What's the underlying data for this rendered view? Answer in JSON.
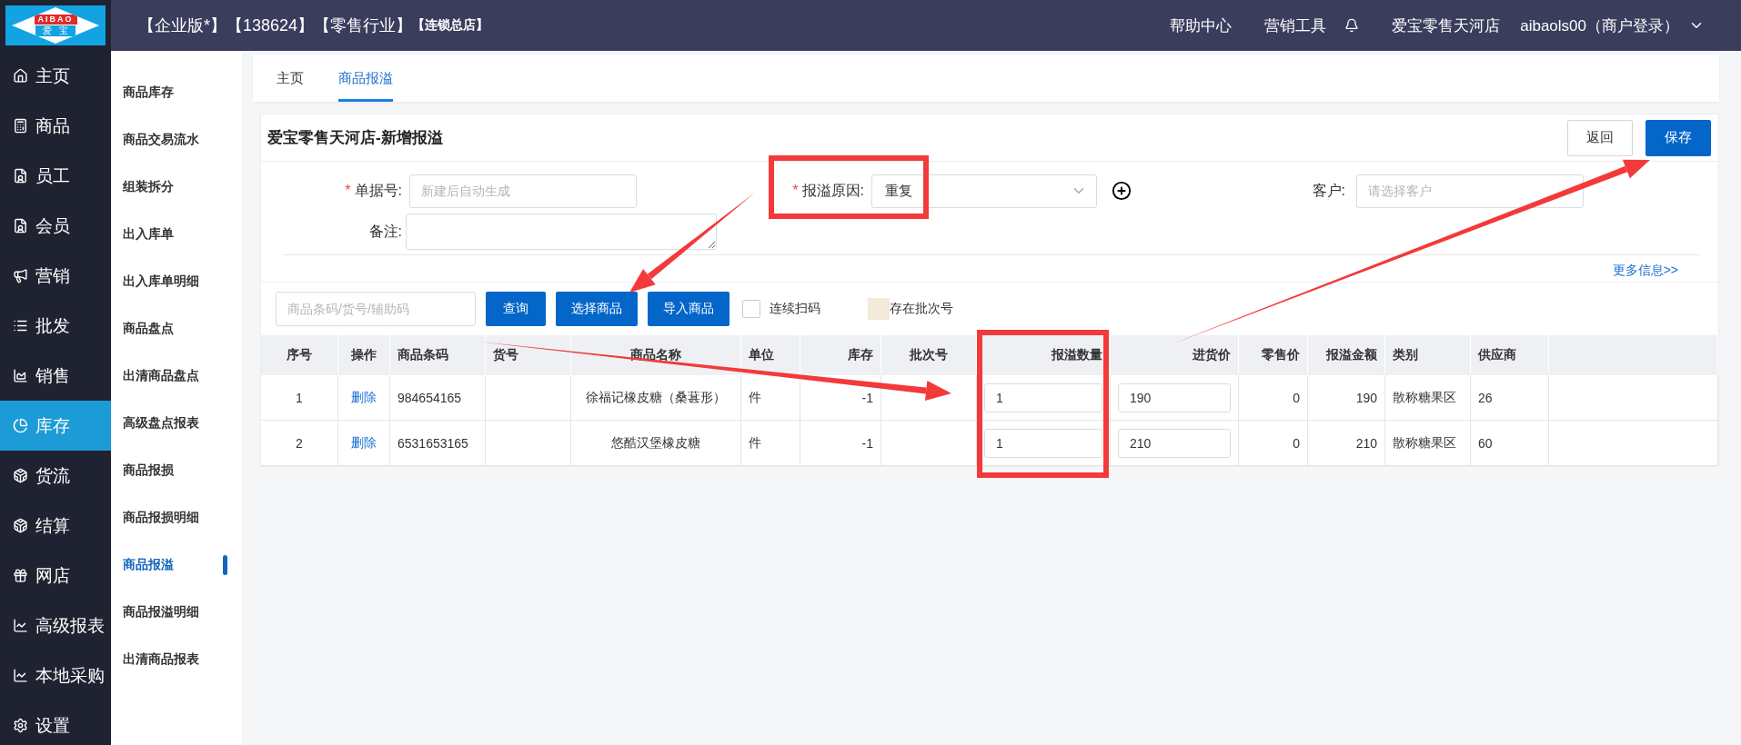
{
  "logo": {
    "brand": "AIBAO",
    "name": "爱宝"
  },
  "top_bar": {
    "badges": [
      {
        "text": "【企业版*】",
        "small": false
      },
      {
        "text": "【138624】",
        "small": false
      },
      {
        "text": "【零售行业】",
        "small": false
      },
      {
        "text": "【连锁总店】",
        "small": true
      }
    ],
    "links": [
      "帮助中心",
      "营销工具"
    ],
    "store": "爱宝零售天河店",
    "user": "aibaols00（商户登录）"
  },
  "nav": [
    {
      "label": "主页",
      "selected": false
    },
    {
      "label": "商品",
      "selected": false
    },
    {
      "label": "员工",
      "selected": false
    },
    {
      "label": "会员",
      "selected": false
    },
    {
      "label": "营销",
      "selected": false
    },
    {
      "label": "批发",
      "selected": false
    },
    {
      "label": "销售",
      "selected": false
    },
    {
      "label": "库存",
      "selected": true
    },
    {
      "label": "货流",
      "selected": false
    },
    {
      "label": "结算",
      "selected": false
    },
    {
      "label": "网店",
      "selected": false
    },
    {
      "label": "高级报表",
      "selected": false
    },
    {
      "label": "本地采购",
      "selected": false
    },
    {
      "label": "设置",
      "selected": false
    }
  ],
  "subnav": [
    {
      "label": "商品库存",
      "selected": false
    },
    {
      "label": "商品交易流水",
      "selected": false
    },
    {
      "label": "组装拆分",
      "selected": false
    },
    {
      "label": "出入库单",
      "selected": false
    },
    {
      "label": "出入库单明细",
      "selected": false
    },
    {
      "label": "商品盘点",
      "selected": false
    },
    {
      "label": "出清商品盘点",
      "selected": false
    },
    {
      "label": "高级盘点报表",
      "selected": false
    },
    {
      "label": "商品报损",
      "selected": false
    },
    {
      "label": "商品报损明细",
      "selected": false
    },
    {
      "label": "商品报溢",
      "selected": true
    },
    {
      "label": "商品报溢明细",
      "selected": false
    },
    {
      "label": "出清商品报表",
      "selected": false
    }
  ],
  "tabs": [
    {
      "label": "主页",
      "selected": false
    },
    {
      "label": "商品报溢",
      "selected": true
    }
  ],
  "card": {
    "title": "爱宝零售天河店-新增报溢",
    "buttons": [
      {
        "label": "返回",
        "kind": "default"
      },
      {
        "label": "保存",
        "kind": "primary"
      }
    ]
  },
  "form": {
    "order_no": {
      "label": "单据号:",
      "required_mark": "*",
      "placeholder": "新建后自动生成"
    },
    "reason": {
      "label": "报溢原因:",
      "required_mark": "*",
      "value": "重复"
    },
    "customer": {
      "label": "客户:",
      "placeholder": "请选择客户"
    },
    "note": {
      "label": "备注:"
    },
    "more_link": "更多信息>>"
  },
  "toolbar": {
    "search_placeholder": "商品条码/货号/辅助码",
    "buttons": [
      "查询",
      "选择商品",
      "导入商品"
    ],
    "continuous_scan": {
      "label": "连续扫码",
      "checked": false
    },
    "legend": {
      "label": "存在批次号",
      "color": "#f3ead9"
    }
  },
  "table": {
    "columns": [
      "序号",
      "操作",
      "商品条码",
      "货号",
      "商品名称",
      "单位",
      "库存",
      "批次号",
      "报溢数量",
      "进货价",
      "零售价",
      "报溢金额",
      "类别",
      "供应商"
    ],
    "rows": [
      {
        "no": "1",
        "action": "删除",
        "barcode": "984654165",
        "name": "徐福记橡皮糖（桑葚形）",
        "unit": "件",
        "stock": "-1",
        "qty": "1",
        "cost": "190",
        "retail": "0",
        "amount": "190",
        "category": "散称糖果区",
        "supplier": "26"
      },
      {
        "no": "2",
        "action": "删除",
        "barcode": "6531653165",
        "name": "悠酷汉堡橡皮糖",
        "unit": "件",
        "stock": "-1",
        "qty": "1",
        "cost": "210",
        "retail": "0",
        "amount": "210",
        "category": "散称糖果区",
        "supplier": "60"
      }
    ]
  }
}
